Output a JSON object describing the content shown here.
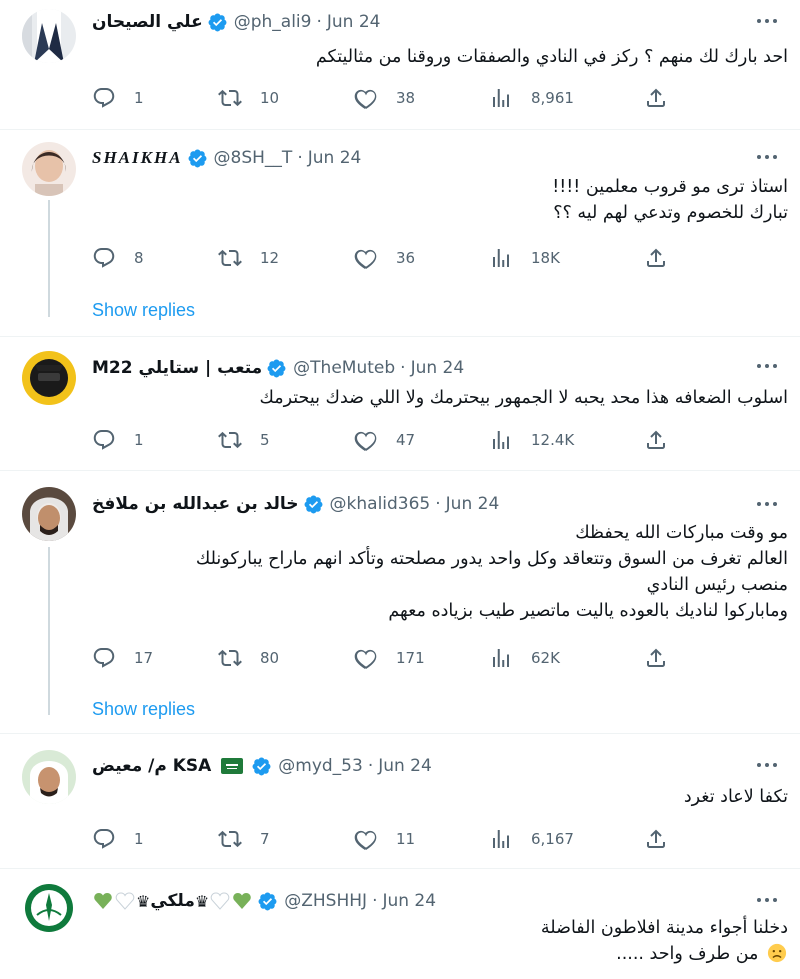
{
  "colors": {
    "verified": "#1d9bf0",
    "text": "#0f1419",
    "secondary": "#536471",
    "link": "#1d9bf0",
    "divider": "#eff3f4",
    "thread": "#cfd9de"
  },
  "tweets": [
    {
      "name": "علي الصيحان",
      "handle": "@ph_ali9",
      "dot": "·",
      "date": "Jun 24",
      "verified": true,
      "lines": [
        "احد بارك لك منهم ؟ ركز في النادي والصفقات وروقنا من مثاليتكم"
      ],
      "replies": "1",
      "retweets": "10",
      "likes": "38",
      "views": "8,961"
    },
    {
      "name": "SHAIKHA",
      "handle": "@8SH__T",
      "dot": "·",
      "date": "Jun 24",
      "verified": true,
      "lines": [
        "استاذ ترى مو قروب معلمين !!!!",
        "تبارك للخصوم وتدعي لهم ليه ؟؟"
      ],
      "replies": "8",
      "retweets": "12",
      "likes": "36",
      "views": "18K",
      "show_replies": "Show replies"
    },
    {
      "name": "M22 متعب | ستايلي",
      "handle": "@TheMuteb",
      "dot": "·",
      "date": "Jun 24",
      "verified": true,
      "lines": [
        "اسلوب الضعافه هذا محد يحبه لا الجمهور بيحترمك ولا اللي ضدك بيحترمك"
      ],
      "replies": "1",
      "retweets": "5",
      "likes": "47",
      "views": "12.4K"
    },
    {
      "name": "خالد بن عبدالله بن ملافخ",
      "handle": "@khalid365",
      "dot": "·",
      "date": "Jun 24",
      "verified": true,
      "lines": [
        "مو وقت مباركات الله يحفظك",
        "العالم تغرف من السوق وتتعاقد وكل واحد يدور مصلحته وتأكد انهم ماراح يباركونلك",
        "منصب رئيس النادي",
        "ومابارکوا لناديك بالعوده ياليت ماتصير طيب بزياده معهم"
      ],
      "replies": "17",
      "retweets": "80",
      "likes": "171",
      "views": "62K",
      "show_replies": "Show replies"
    },
    {
      "name": "م/ معيض KSA",
      "handle": "@myd_53",
      "dot": "·",
      "date": "Jun 24",
      "verified": true,
      "lines": [
        "تكفا لاعاد تغرد"
      ],
      "replies": "1",
      "retweets": "7",
      "likes": "11",
      "views": "6,167"
    },
    {
      "name": "ملكي",
      "handle": "@ZHSHHJ",
      "dot": "·",
      "date": "Jun 24",
      "verified": true,
      "lines": [
        "دخلنا أجواء مدينة افلاطون الفاضلة",
        "من طرف واحد ....."
      ]
    }
  ],
  "icons": [
    "reply-icon",
    "retweet-icon",
    "like-icon",
    "views-icon",
    "share-icon",
    "verified-badge-icon",
    "more-icon"
  ]
}
